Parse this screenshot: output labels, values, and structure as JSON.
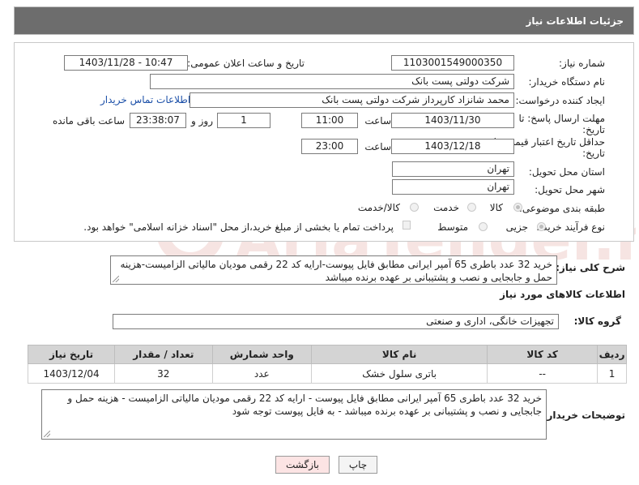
{
  "header": {
    "title": "جزئیات اطلاعات نیاز"
  },
  "form": {
    "need_number_label": "شماره نیاز:",
    "need_number": "1103001549000350",
    "announce_label": "تاریخ و ساعت اعلان عمومی:",
    "announce_value": "1403/11/28 - 10:47",
    "buyer_org_label": "نام دستگاه خریدار:",
    "buyer_org": "شرکت دولتی پست بانک",
    "creator_label": "ایجاد کننده درخواست:",
    "creator": "محمد شانزاد کارپرداز شرکت دولتی پست بانک",
    "contact_link": "اطلاعات تماس خریدار",
    "deadline_label_1": "مهلت ارسال پاسخ: تا",
    "deadline_label_2": "تاریخ:",
    "deadline_date": "1403/11/30",
    "time_word": "ساعت",
    "deadline_time": "11:00",
    "days_value": "1",
    "days_word": "روز و",
    "remaining_time": "23:38:07",
    "remaining_word": "ساعت باقی مانده",
    "validity_label_1": "حداقل تاریخ اعتبار قیمت: تا",
    "validity_label_2": "تاریخ:",
    "validity_date": "1403/12/18",
    "validity_time": "23:00",
    "province_label": "استان محل تحویل:",
    "province": "تهران",
    "city_label": "شهر محل تحویل:",
    "city": "تهران",
    "category_label": "طبقه بندی موضوعی:",
    "category_options": [
      "کالا",
      "خدمت",
      "کالا/خدمت"
    ],
    "process_label": "نوع فرآیند خرید :",
    "process_options": [
      "جزیی",
      "متوسط"
    ],
    "payment_note": "پرداخت تمام یا بخشی از مبلغ خرید،از محل \"اسناد خزانه اسلامی\" خواهد بود."
  },
  "summary": {
    "label": "شرح کلی نیاز:",
    "text": "خرید 32 عدد باطری 65 آمپر ایرانی مطابق فایل پیوست-ارایه کد 22 رقمی مودیان مالیاتی الزامیست-هزینه حمل و جابجایی و نصب و پشتیبانی بر عهده برنده میباشد"
  },
  "goods": {
    "section_title": "اطلاعات کالاهای مورد نیاز",
    "group_label": "گروه کالا:",
    "group_value": "تجهیزات خانگی، اداری و صنعتی",
    "columns": [
      "ردیف",
      "کد کالا",
      "نام کالا",
      "واحد شمارش",
      "تعداد / مقدار",
      "تاریخ نیاز"
    ],
    "rows": [
      {
        "row": "1",
        "code": "--",
        "name": "باتری سلول خشک",
        "unit": "عدد",
        "qty": "32",
        "date": "1403/12/04"
      }
    ]
  },
  "buyer_notes": {
    "label": "توضیحات خریدار:",
    "text": "خرید 32 عدد باطری 65 آمپر ایرانی مطابق فایل پیوست - ارایه کد 22 رقمی مودیان مالیاتی الزامیست - هزینه حمل و جابجایی و نصب و پشتیبانی بر عهده برنده میباشد - به فایل پیوست توجه شود"
  },
  "buttons": {
    "print": "چاپ",
    "back": "بازگشت"
  },
  "watermark": {
    "text": "AriaTender.neT"
  },
  "colors": {
    "header_bg": "#6d6d6d",
    "link": "#1b4fa8",
    "back_button_bg": "#fce4e4",
    "table_header": "#d4d4d4"
  }
}
